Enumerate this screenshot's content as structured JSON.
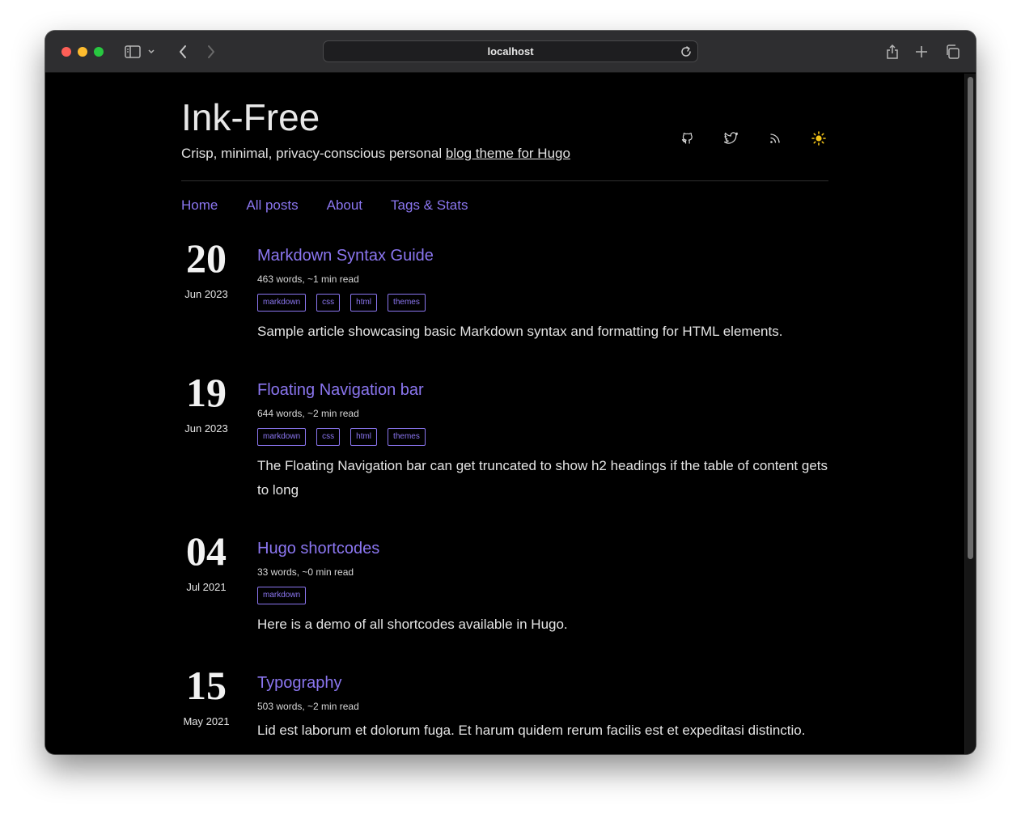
{
  "browser": {
    "url": "localhost",
    "colors": {
      "close": "#fe5f57",
      "minimize": "#febc2e",
      "zoom": "#28c840"
    }
  },
  "site": {
    "title": "Ink-Free",
    "tagline_prefix": "Crisp, minimal, privacy-conscious personal ",
    "tagline_link": "blog theme for Hugo",
    "accent_color": "#8b76f0",
    "social_icons": [
      "github-icon",
      "twitter-icon",
      "rss-icon",
      "sun-icon"
    ]
  },
  "nav": {
    "items": [
      {
        "label": "Home"
      },
      {
        "label": "All posts"
      },
      {
        "label": "About"
      },
      {
        "label": "Tags & Stats"
      }
    ]
  },
  "posts": [
    {
      "day": "20",
      "month": "Jun 2023",
      "title": "Markdown Syntax Guide",
      "meta": "463 words, ~1 min read",
      "tags": [
        "markdown",
        "css",
        "html",
        "themes"
      ],
      "summary": "Sample article showcasing basic Markdown syntax and formatting for HTML elements."
    },
    {
      "day": "19",
      "month": "Jun 2023",
      "title": "Floating Navigation bar",
      "meta": "644 words, ~2 min read",
      "tags": [
        "markdown",
        "css",
        "html",
        "themes"
      ],
      "summary": "The Floating Navigation bar can get truncated to show h2 headings if the table of content gets to long"
    },
    {
      "day": "04",
      "month": "Jul 2021",
      "title": "Hugo shortcodes",
      "meta": "33 words, ~0 min read",
      "tags": [
        "markdown"
      ],
      "summary": "Here is a demo of all shortcodes available in Hugo."
    },
    {
      "day": "15",
      "month": "May 2021",
      "title": "Typography",
      "meta": "503 words, ~2 min read",
      "tags": [],
      "summary": "Lid est laborum et dolorum fuga. Et harum quidem rerum facilis est et expeditasi distinctio."
    }
  ]
}
